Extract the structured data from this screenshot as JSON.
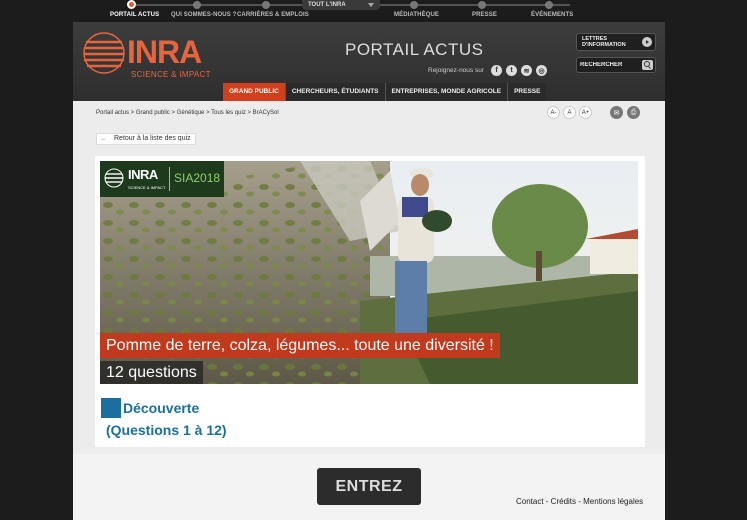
{
  "top_nav": {
    "items": [
      {
        "label": "PORTAIL ACTUS",
        "active": true
      },
      {
        "label": "QUI SOMMES-NOUS ?"
      },
      {
        "label": "CARRIÈRES & EMPLOIS"
      },
      {
        "label": "MÉDIATHÈQUE"
      },
      {
        "label": "PRESSE"
      },
      {
        "label": "ÉVÉNEMENTS"
      }
    ],
    "dropdown_label": "TOUT L'INRA"
  },
  "header": {
    "logo_text": "INRA",
    "logo_tagline": "SCIENCE & IMPACT",
    "portal_title": "PORTAIL ACTUS",
    "social_text": "Rejoignez-nous sur",
    "social": [
      {
        "icon": "facebook-icon",
        "glyph": "f"
      },
      {
        "icon": "twitter-icon",
        "glyph": "t"
      },
      {
        "icon": "rss-icon",
        "glyph": "≋"
      },
      {
        "icon": "instagram-icon",
        "glyph": "◎"
      }
    ],
    "newsletter_line1": "LETTRES",
    "newsletter_line2": "D'INFORMATION",
    "search_placeholder": "RECHERCHER",
    "tabs": [
      "GRAND PUBLIC",
      "CHERCHEURS, ÉTUDIANTS",
      "ENTREPRISES, MONDE AGRICOLE",
      "PRESSE"
    ]
  },
  "breadcrumb": "Portail actus > Grand public > Génétique > Tous les quiz > BrACySol",
  "font_controls": [
    "A-",
    "A",
    "A+"
  ],
  "back_link": "Retour à la liste des quiz",
  "banner": {
    "badge_logo": "INRA",
    "badge_tagline": "SCIENCE & IMPACT",
    "badge_year": "SIA2018",
    "quiz_title": "Pomme de terre, colza, légumes... toute une diversité !",
    "quiz_count": "12 questions"
  },
  "section": {
    "title": "Découverte",
    "range": "(Questions 1 à 12)"
  },
  "footer": {
    "enter_label": "ENTREZ",
    "links": "Contact - Crédits - Mentions légales"
  },
  "colors": {
    "accent": "#d1401c",
    "brand": "#e8643c",
    "link_blue": "#1a6fa0"
  }
}
